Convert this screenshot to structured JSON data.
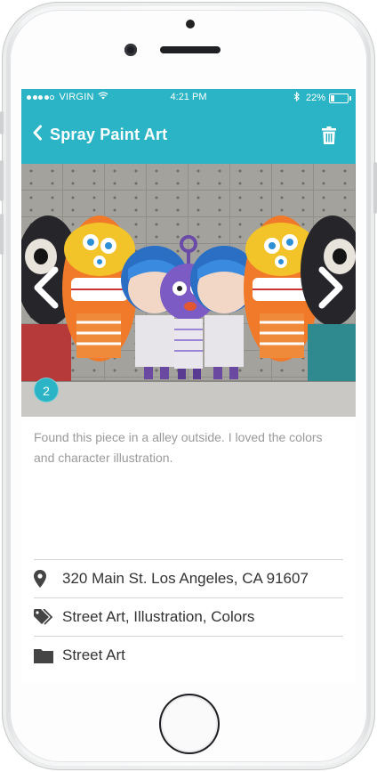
{
  "status_bar": {
    "carrier": "VIRGIN",
    "time": "4:21 PM",
    "battery": "22%",
    "battery_level": 0.22,
    "signal_bars_filled": 4
  },
  "nav": {
    "title": "Spray Paint Art",
    "back_icon": "chevron-left-icon",
    "action_icon": "trash-icon"
  },
  "gallery": {
    "current_index": "2",
    "prev_icon": "chevron-left-icon",
    "next_icon": "chevron-right-icon"
  },
  "description": "Found this piece in a alley outside.  I loved the colors and character illustration.",
  "details": {
    "address": "320 Main St. Los Angeles, CA 91607",
    "tags": "Street Art, Illustration, Colors",
    "folder": "Street Art"
  },
  "colors": {
    "accent": "#2ab4c5",
    "text_primary": "#333333",
    "text_muted": "#9a9a9a"
  }
}
